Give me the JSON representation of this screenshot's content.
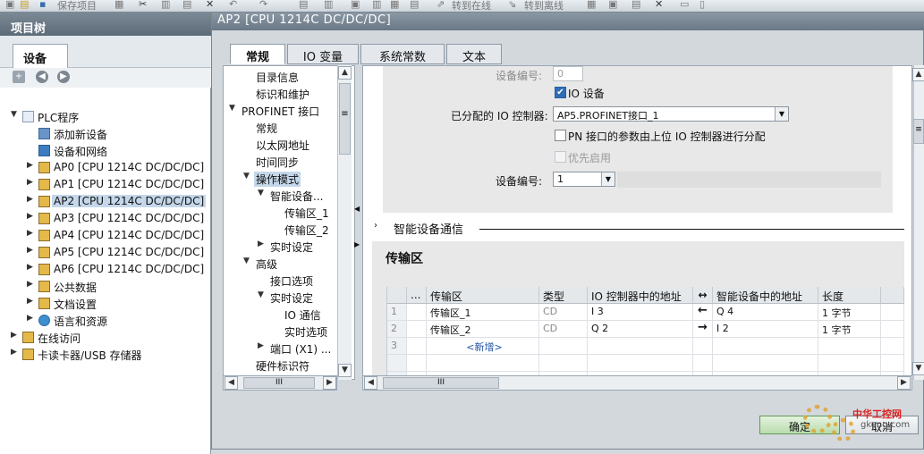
{
  "toolbar": {
    "save": "保存项目",
    "go_online": "转到在线",
    "go_offline": "转到离线"
  },
  "left_panel": {
    "title": "项目树",
    "tab": "设备",
    "tree": [
      {
        "label": "PLC程序"
      },
      {
        "label": "添加新设备"
      },
      {
        "label": "设备和网络"
      },
      {
        "label": "AP0 [CPU 1214C DC/DC/DC]"
      },
      {
        "label": "AP1 [CPU 1214C DC/DC/DC]"
      },
      {
        "label": "AP2 [CPU 1214C DC/DC/DC]"
      },
      {
        "label": "AP3 [CPU 1214C DC/DC/DC]"
      },
      {
        "label": "AP4 [CPU 1214C DC/DC/DC]"
      },
      {
        "label": "AP5 [CPU 1214C DC/DC/DC]"
      },
      {
        "label": "AP6 [CPU 1214C DC/DC/DC]"
      },
      {
        "label": "公共数据"
      },
      {
        "label": "文档设置"
      },
      {
        "label": "语言和资源"
      },
      {
        "label": "在线访问"
      },
      {
        "label": "卡读卡器/USB 存储器"
      }
    ]
  },
  "dialog": {
    "title": "AP2 [CPU 1214C DC/DC/DC]",
    "tabs": [
      {
        "label": "常规"
      },
      {
        "label": "IO 变量"
      },
      {
        "label": "系统常数"
      },
      {
        "label": "文本"
      }
    ],
    "nav": [
      {
        "label": "目录信息"
      },
      {
        "label": "标识和维护"
      },
      {
        "label": "PROFINET 接口"
      },
      {
        "label": "常规"
      },
      {
        "label": "以太网地址"
      },
      {
        "label": "时间同步"
      },
      {
        "label": "操作模式"
      },
      {
        "label": "智能设备..."
      },
      {
        "label": "传输区_1"
      },
      {
        "label": "传输区_2"
      },
      {
        "label": "实时设定"
      },
      {
        "label": "高级"
      },
      {
        "label": "接口选项"
      },
      {
        "label": "实时设定"
      },
      {
        "label": "IO 通信"
      },
      {
        "label": "实时选项"
      },
      {
        "label": "端口 (X1) ..."
      },
      {
        "label": "硬件标识符"
      }
    ],
    "mode": {
      "device_number_label": "设备编号:",
      "device_number_value": "0",
      "io_device_label": "IO 设备",
      "assigned_controller_label": "已分配的 IO 控制器:",
      "assigned_controller_value": "AP5.PROFINET接口_1",
      "pn_param_label": "PN 接口的参数由上位 IO 控制器进行分配",
      "prio_label": "优先启用",
      "device_number2_label": "设备编号:",
      "device_number2_value": "1"
    },
    "smart_section_title": "智能设备通信",
    "transfer": {
      "title": "传输区",
      "headers": [
        "...",
        "传输区",
        "类型",
        "IO 控制器中的地址",
        "↔",
        "智能设备中的地址",
        "长度"
      ],
      "rows": [
        {
          "num": "1",
          "name": "传输区_1",
          "type": "CD",
          "ctrl_addr": "I 3",
          "dir": "←",
          "dev_addr": "Q 4",
          "len": "1 字节"
        },
        {
          "num": "2",
          "name": "传输区_2",
          "type": "CD",
          "ctrl_addr": "Q 2",
          "dir": "→",
          "dev_addr": "I 2",
          "len": "1 字节"
        },
        {
          "num": "3",
          "name": "<新增>",
          "type": "",
          "ctrl_addr": "",
          "dir": "",
          "dev_addr": "",
          "len": ""
        }
      ]
    },
    "ok_button": "确定",
    "cancel_button": "取消",
    "hscroll_label": "III"
  },
  "watermark": {
    "text": "中华工控网",
    "url": "gkong.com"
  }
}
